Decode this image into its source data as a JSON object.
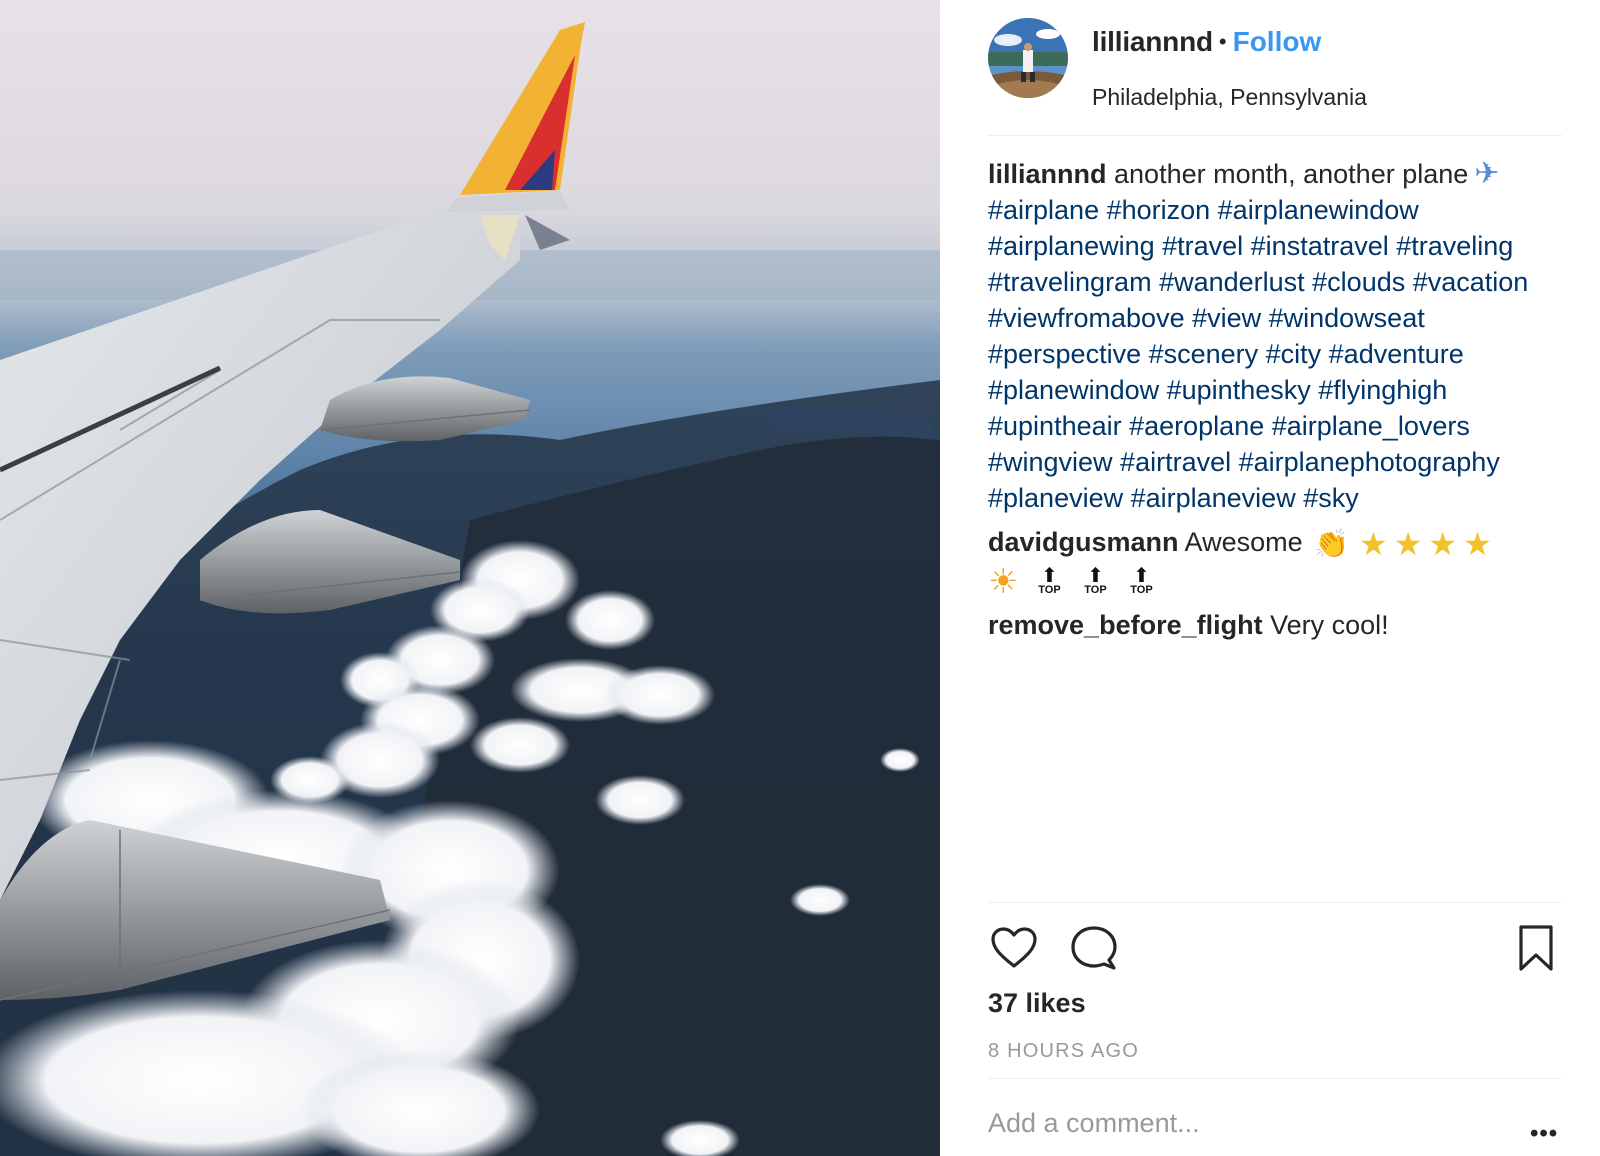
{
  "post": {
    "username": "lilliannnd",
    "separator": "•",
    "follow_label": "Follow",
    "location": "Philadelphia, Pennsylvania",
    "avatar_icon": "user-avatar-photo",
    "photo_icon": "airplane-wing-photo"
  },
  "caption": {
    "username": "lilliannnd",
    "text": "another month, another plane",
    "emoji": "✈",
    "hashtags": "#airplane #horizon #airplanewindow #airplanewing #travel #instatravel #traveling #travelingram #wanderlust #clouds #vacation #viewfromabove #view #windowseat #perspective #scenery #city #adventure #planewindow #upinthesky #flyinghigh #upintheair #aeroplane #airplane_lovers #wingview #airtravel #airplanephotography #planeview #airplaneview #sky"
  },
  "comments": [
    {
      "username": "davidgusmann",
      "text": "Awesome",
      "emojis": {
        "clap": "👏",
        "star": "★",
        "sun": "☀",
        "top_arrow": "⬆",
        "top_label": "TOP"
      }
    },
    {
      "username": "remove_before_flight",
      "text": "Very cool!"
    }
  ],
  "actions": {
    "like_icon": "heart-icon",
    "comment_icon": "comment-bubble-icon",
    "save_icon": "bookmark-icon"
  },
  "likes_text": "37 likes",
  "time_text": "8 HOURS AGO",
  "add_comment_placeholder": "Add a comment...",
  "more_label": "•••",
  "colors": {
    "follow": "#3897f0",
    "hashtag": "#003569",
    "muted": "#999999",
    "text": "#262626",
    "divider": "#efefef"
  }
}
